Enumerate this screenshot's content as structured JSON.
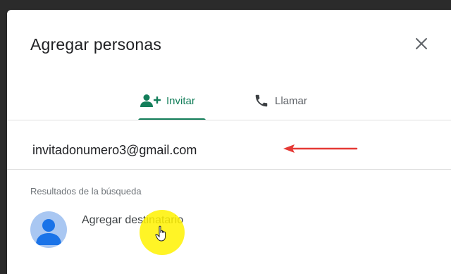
{
  "dialog": {
    "title": "Agregar personas",
    "close_icon": "close-icon"
  },
  "tabs": [
    {
      "label": "Invitar",
      "icon": "person-add-icon",
      "active": true
    },
    {
      "label": "Llamar",
      "icon": "phone-icon",
      "active": false
    }
  ],
  "input": {
    "value": "invitadonumero3@gmail.com"
  },
  "results": {
    "heading": "Resultados de la búsqueda",
    "items": [
      {
        "label": "Agregar destinatario",
        "icon": "person-avatar-icon"
      }
    ]
  },
  "colors": {
    "accent": "#137e5a",
    "arrow": "#e53935",
    "highlight": "#fff200",
    "avatar_bg": "#a9c7f2",
    "avatar_fg": "#1a73e8"
  }
}
